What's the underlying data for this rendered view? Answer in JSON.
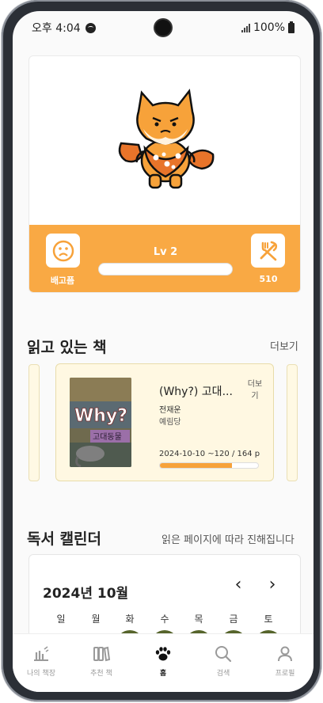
{
  "status_bar": {
    "time": "오후 4:04",
    "battery": "100%"
  },
  "pet": {
    "left_label": "배고픔",
    "level": "Lv 2",
    "right_label": "510",
    "xp_progress": 0.0,
    "accent_color": "#f9a944"
  },
  "reading": {
    "title": "읽고 있는 책",
    "more": "더보기",
    "book": {
      "title": "(Why?) 고대...",
      "more_mini": "더보기",
      "author": "전재운",
      "publisher": "예림당",
      "progress_text": "2024-10-10 ~120 / 164 p",
      "progress_fraction": 0.73,
      "cover_title": "Why?",
      "cover_subtitle": "고대동물"
    }
  },
  "calendar": {
    "title": "독서 캘린더",
    "note": "읽은 페이지에 따라 진해집니다",
    "month": "2024년 10월",
    "prev": "‹",
    "next": "›",
    "weekdays": [
      "일",
      "월",
      "화",
      "수",
      "목",
      "금",
      "토"
    ],
    "read_day_color": "#56642b"
  },
  "tabs": [
    {
      "label": "나의 책장",
      "icon": "bookshelf-icon"
    },
    {
      "label": "추천 책",
      "icon": "books-icon"
    },
    {
      "label": "홈",
      "icon": "paw-icon"
    },
    {
      "label": "검색",
      "icon": "search-icon"
    },
    {
      "label": "프로필",
      "icon": "profile-icon"
    }
  ]
}
